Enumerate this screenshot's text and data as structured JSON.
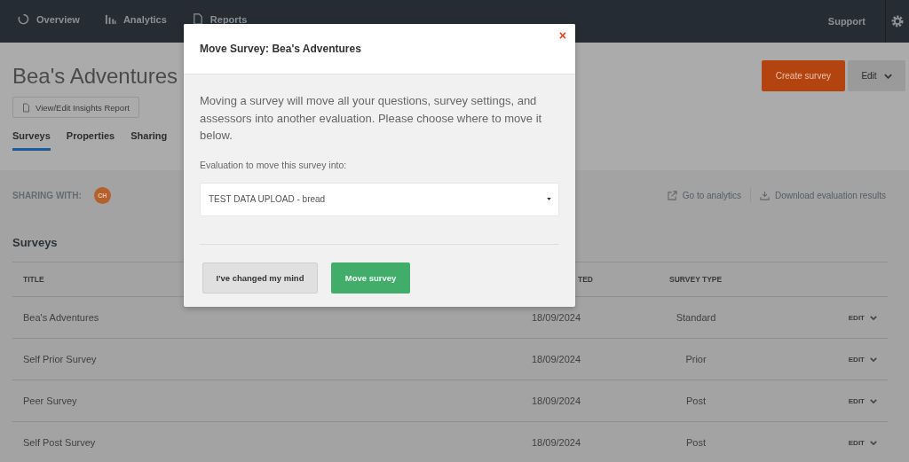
{
  "nav": {
    "items": [
      {
        "label": "Overview"
      },
      {
        "label": "Analytics"
      },
      {
        "label": "Reports"
      }
    ],
    "support": "Support"
  },
  "page": {
    "title": "Bea's Adventures",
    "report_button": "View/Edit Insights Report",
    "create_button": "Create survey",
    "edit_button": "Edit"
  },
  "tabs": [
    {
      "label": "Surveys",
      "selected": true
    },
    {
      "label": "Properties",
      "selected": false
    },
    {
      "label": "Sharing",
      "selected": false
    }
  ],
  "sharing": {
    "label": "SHARING WITH:",
    "avatar": "CH"
  },
  "links": {
    "analytics": "Go to analytics",
    "download": "Download evaluation results"
  },
  "surveys": {
    "heading": "Surveys",
    "columns": [
      "TITLE",
      "TED",
      "SURVEY TYPE"
    ],
    "rows": [
      {
        "title": "Bea's Adventures",
        "date": "18/09/2024",
        "type": "Standard",
        "action": "EDIT"
      },
      {
        "title": "Self Prior Survey",
        "date": "18/09/2024",
        "type": "Prior",
        "action": "EDIT"
      },
      {
        "title": "Peer Survey",
        "date": "18/09/2024",
        "type": "Post",
        "action": "EDIT"
      },
      {
        "title": "Self Post Survey",
        "date": "18/09/2024",
        "type": "Post",
        "action": "EDIT"
      }
    ]
  },
  "modal": {
    "title": "Move Survey: **Bea's Adventures**",
    "close": "×",
    "description": "Moving a survey will move all your questions, survey settings, and assessors into another evaluation. Please choose where to move it below.",
    "field_label": "Evaluation to move this survey into:",
    "select_value": "TEST DATA UPLOAD - bread",
    "cancel_button": "I've changed my mind",
    "confirm_button": "Move survey"
  }
}
